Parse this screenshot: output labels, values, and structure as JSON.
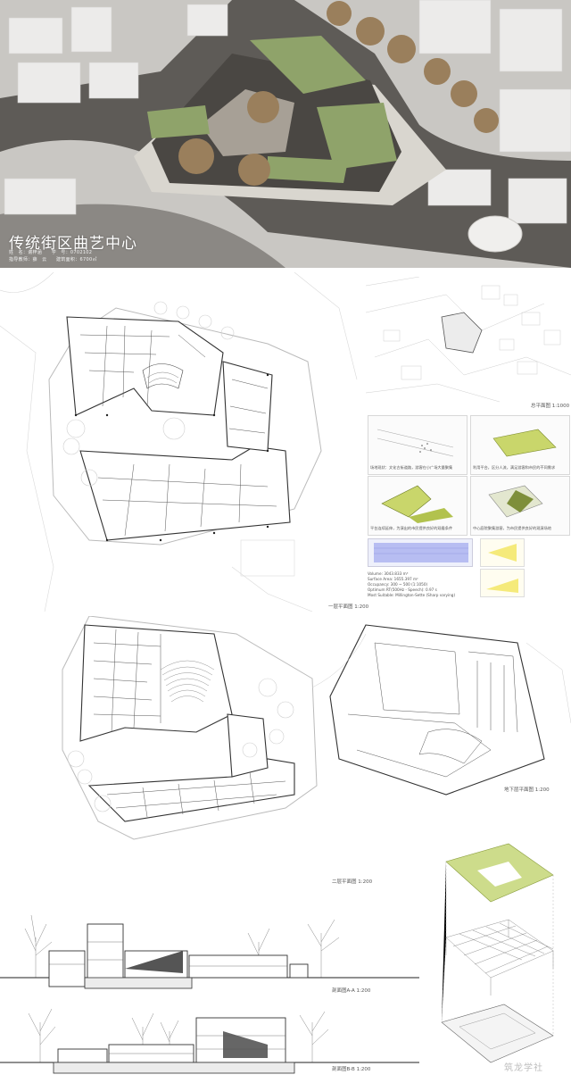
{
  "poster": {
    "title": "传统街区曲艺中心",
    "meta_line1": "姓　名：谢梓涵　　学　号：0702102",
    "meta_line2": "指导教师：薛　云　　建筑面积：6700㎡"
  },
  "plans": {
    "first_floor": "一层平面图 1:200",
    "second_floor": "二层平面图 1:200",
    "basement": "地下层平面图 1:200",
    "site": "总平面图 1:1000"
  },
  "analysis": {
    "step1": "场地现状：文化古街道路，游客在小广场大量聚集",
    "step2": "利用平台，区分人流，满足游客和市民的不同需求",
    "step3": "平台连续延伸，为演出的市民提供良好的观看条件",
    "step4": "中心庭院聚集游客，为市民提供良好的观演场地",
    "acoustics": [
      "Volume: 3043.833 m³",
      "Surface Area: 1655.397 m²",
      "Occupancy: 300 ~ 500 (1:1050)",
      "Optimum RT(500Hz - Speech): 0.97 s",
      "Most Suitable: Millington-Sette (Sharp varying)"
    ]
  },
  "sections": {
    "a": "剖面图A-A 1:200",
    "b": "剖面图B-B 1:200"
  },
  "watermark": "筑龙学社"
}
